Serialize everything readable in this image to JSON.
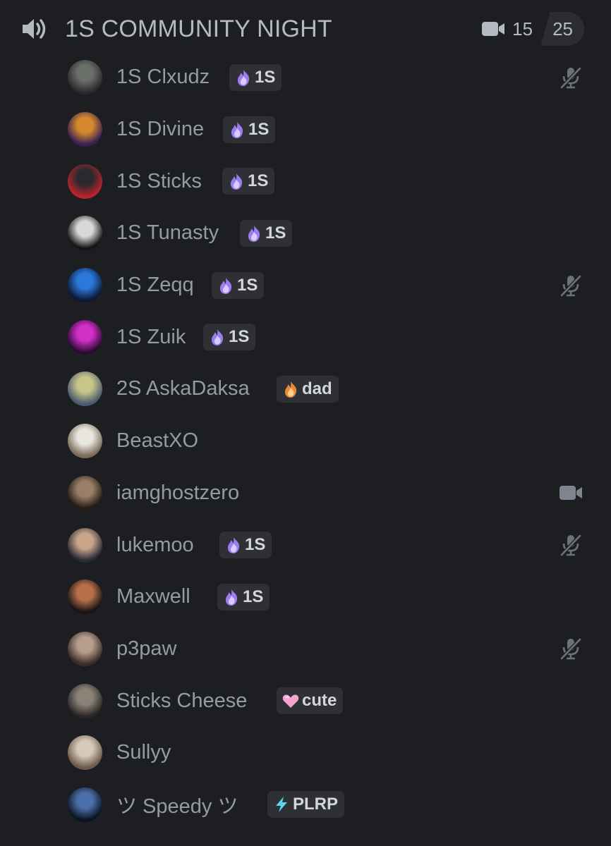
{
  "channel": {
    "name": "1S COMMUNITY NIGHT",
    "speaker_icon": "speaker-icon",
    "video_icon": "video-icon",
    "current_count": "15",
    "limit": "25"
  },
  "users": [
    {
      "name": "1S Clxudz",
      "tag": "1S",
      "tag_icon": "purple-flame-icon",
      "status": "mic-muted-icon",
      "avatar_colors": [
        "#6b6f6a",
        "#2a2b2b"
      ]
    },
    {
      "name": "1S Divine",
      "tag": "1S",
      "tag_icon": "purple-flame-icon",
      "status": "",
      "avatar_colors": [
        "#d48a2c",
        "#3a1f52"
      ]
    },
    {
      "name": "1S Sticks",
      "tag": "1S",
      "tag_icon": "purple-flame-icon",
      "status": "",
      "avatar_colors": [
        "#2a2a2e",
        "#b8232e"
      ]
    },
    {
      "name": "1S Tunasty",
      "tag": "1S",
      "tag_icon": "purple-flame-icon",
      "status": "",
      "avatar_colors": [
        "#d8d8d8",
        "#151515"
      ]
    },
    {
      "name": "1S Zeqq",
      "tag": "1S",
      "tag_icon": "purple-flame-icon",
      "status": "mic-muted-icon",
      "avatar_colors": [
        "#2a78d8",
        "#0c1a3a"
      ]
    },
    {
      "name": "1S Zuik",
      "tag": "1S",
      "tag_icon": "purple-flame-icon",
      "status": "",
      "avatar_colors": [
        "#d22fc6",
        "#2b0a33"
      ]
    },
    {
      "name": "2S AskaDaksa",
      "tag": "dad",
      "tag_icon": "orange-flame-icon",
      "status": "",
      "avatar_colors": [
        "#c9c48a",
        "#4a5a6e"
      ]
    },
    {
      "name": "BeastXO",
      "tag": "",
      "tag_icon": "",
      "status": "",
      "avatar_colors": [
        "#e9e6de",
        "#7a6a58"
      ]
    },
    {
      "name": "iamghostzero",
      "tag": "",
      "tag_icon": "",
      "status": "video-icon",
      "avatar_colors": [
        "#9a7f66",
        "#221b16"
      ]
    },
    {
      "name": "lukemoo",
      "tag": "1S",
      "tag_icon": "purple-flame-icon",
      "status": "mic-muted-icon",
      "avatar_colors": [
        "#c9a58c",
        "#2a2a33"
      ]
    },
    {
      "name": "Maxwell",
      "tag": "1S",
      "tag_icon": "purple-flame-icon",
      "status": "",
      "avatar_colors": [
        "#b8704a",
        "#1a1414"
      ]
    },
    {
      "name": "p3paw",
      "tag": "",
      "tag_icon": "",
      "status": "mic-muted-icon",
      "avatar_colors": [
        "#b79d8c",
        "#3a2c28"
      ]
    },
    {
      "name": "Sticks Cheese",
      "tag": "cute",
      "tag_icon": "pink-heart-icon",
      "status": "",
      "avatar_colors": [
        "#8c8378",
        "#2c2826"
      ]
    },
    {
      "name": "Sullyy",
      "tag": "",
      "tag_icon": "",
      "status": "",
      "avatar_colors": [
        "#d7c9b8",
        "#6b5a4a"
      ]
    },
    {
      "name": "ツ Speedy ツ",
      "tag": "PLRP",
      "tag_icon": "lightning-icon",
      "status": "",
      "avatar_colors": [
        "#4b6fa8",
        "#0b1422"
      ]
    }
  ],
  "colors": {
    "background": "#1d1e22",
    "text": "#949ba4",
    "tag_bg": "#2e3035",
    "purple_flame": "#a78bfa",
    "orange_flame": "#e8893a",
    "pink_heart": "#f4a3cf",
    "lightning": "#5fd4f0"
  }
}
